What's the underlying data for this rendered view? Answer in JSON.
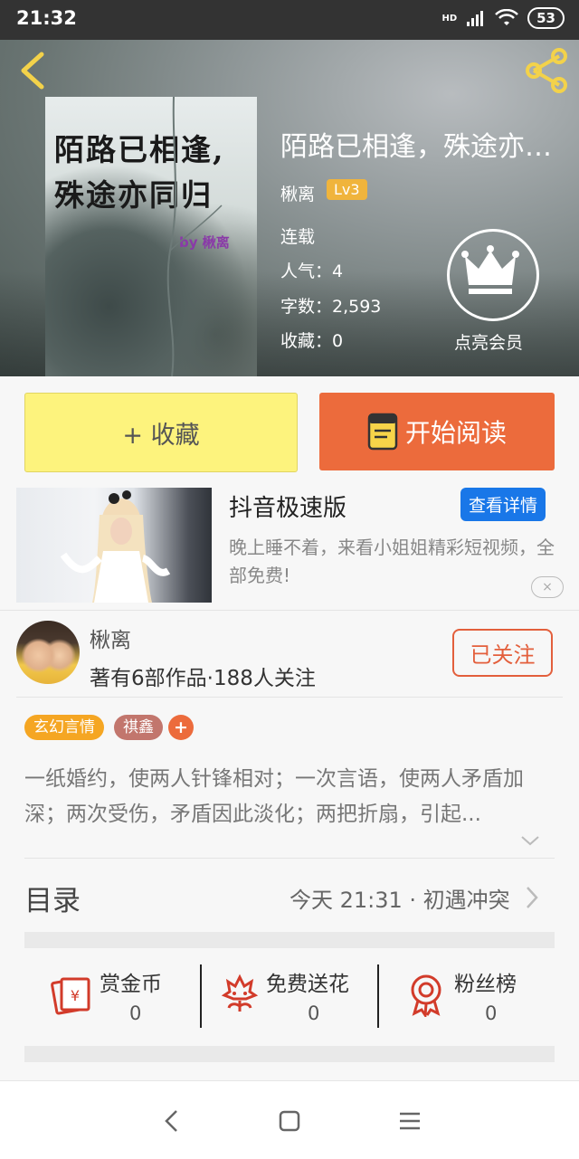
{
  "status_bar": {
    "time": "21:32",
    "network": "HD",
    "battery": "53"
  },
  "book": {
    "title": "陌路已相逢，殊途亦同归",
    "cover_title_line1": "陌路已相逢,",
    "cover_title_line2": "殊途亦同归",
    "cover_author": "by  楸离",
    "author": "楸离",
    "author_level": "Lv3",
    "status": "连载",
    "popularity_label": "人气：4",
    "word_count_label": "字数：2,593",
    "favorites_label": "收藏：0"
  },
  "vip": {
    "label": "点亮会员"
  },
  "actions": {
    "favorite_label": "+ 收藏",
    "read_label": "开始阅读"
  },
  "ad": {
    "title": "抖音极速版",
    "detail_button": "查看详情",
    "description": "晚上睡不着，来看小姐姐精彩短视频，全部免费!",
    "close_icon": "×"
  },
  "author_card": {
    "name": "楸离",
    "stats": "著有6部作品·188人关注",
    "follow_label": "已关注"
  },
  "tags": [
    "玄幻言情",
    "祺鑫"
  ],
  "tag_add_label": "+",
  "synopsis": "一纸婚约，使两人针锋相对；一次言语，使两人矛盾加深；两次受伤，矛盾因此淡化；两把折扇，引起...",
  "toc": {
    "label": "目录",
    "latest": "今天 21:31 · 初遇冲突"
  },
  "stats": [
    {
      "label": "赏金币",
      "value": "0",
      "icon": "red-envelope-icon"
    },
    {
      "label": "免费送花",
      "value": "0",
      "icon": "flower-icon"
    },
    {
      "label": "粉丝榜",
      "value": "0",
      "icon": "medal-icon"
    }
  ],
  "colors": {
    "accent": "#ec6b3c",
    "favorite_bg": "#fdf37d",
    "level_badge": "#f0b43c",
    "ad_button": "#1977e8",
    "stat_icon": "#d23b2a"
  }
}
